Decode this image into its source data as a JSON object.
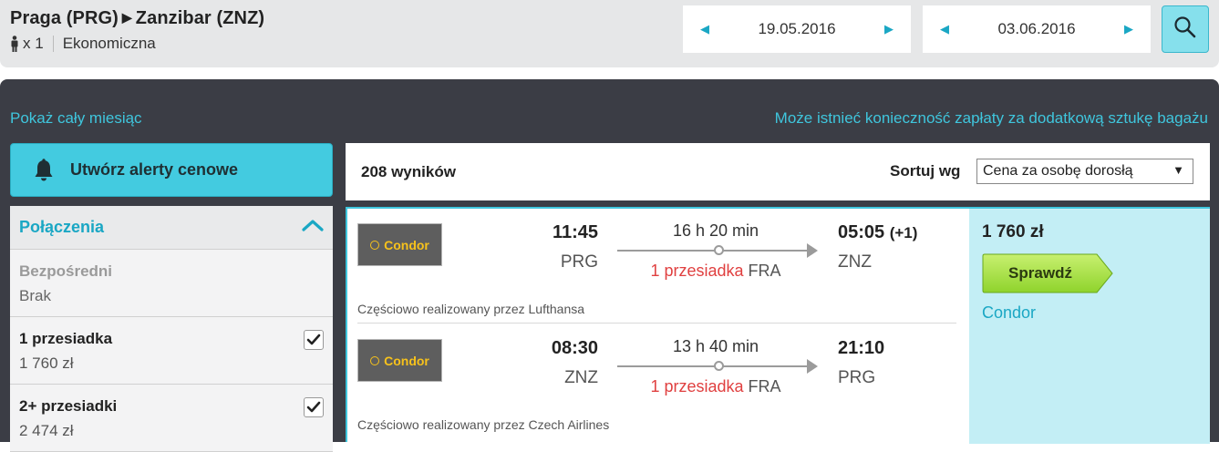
{
  "header": {
    "origin": "Praga (PRG)",
    "destination": "Zanzibar (ZNZ)",
    "passengers": "x 1",
    "cabin": "Ekonomiczna",
    "date_out": "19.05.2016",
    "date_return": "03.06.2016"
  },
  "links": {
    "show_month": "Pokaż cały miesiąc",
    "baggage_note": "Może istnieć konieczność zapłaty za dodatkową sztukę bagażu"
  },
  "alert_button": "Utwórz alerty cenowe",
  "filters": {
    "title": "Połączenia",
    "rows": [
      {
        "name": "Bezpośredni",
        "value": "Brak",
        "checked": false
      },
      {
        "name": "1 przesiadka",
        "value": "1 760 zł",
        "checked": true
      },
      {
        "name": "2+ przesiadki",
        "value": "2 474 zł",
        "checked": true
      }
    ]
  },
  "results": {
    "count": "208 wyników",
    "sort_label": "Sortuj wg",
    "sort_value": "Cena za osobę dorosłą"
  },
  "offer": {
    "price": "1 760 zł",
    "check_button": "Sprawdź",
    "provider": "Condor",
    "legs": [
      {
        "airline": "Condor",
        "dep_time": "11:45",
        "dep_airport": "PRG",
        "duration": "16 h 20 min",
        "stops": "1 przesiadka",
        "stop_airport": "FRA",
        "arr_time": "05:05",
        "arr_offset": "(+1)",
        "arr_airport": "ZNZ",
        "operated_by": "Częściowo realizowany przez Lufthansa"
      },
      {
        "airline": "Condor",
        "dep_time": "08:30",
        "dep_airport": "ZNZ",
        "duration": "13 h 40 min",
        "stops": "1 przesiadka",
        "stop_airport": "FRA",
        "arr_time": "21:10",
        "arr_offset": "",
        "arr_airport": "PRG",
        "operated_by": "Częściowo realizowany przez Czech Airlines"
      }
    ]
  },
  "colors": {
    "accent": "#3fc6dd",
    "dark_panel": "#3b3d45",
    "stops_red": "#e04040",
    "check_green": "#a6e04a"
  }
}
